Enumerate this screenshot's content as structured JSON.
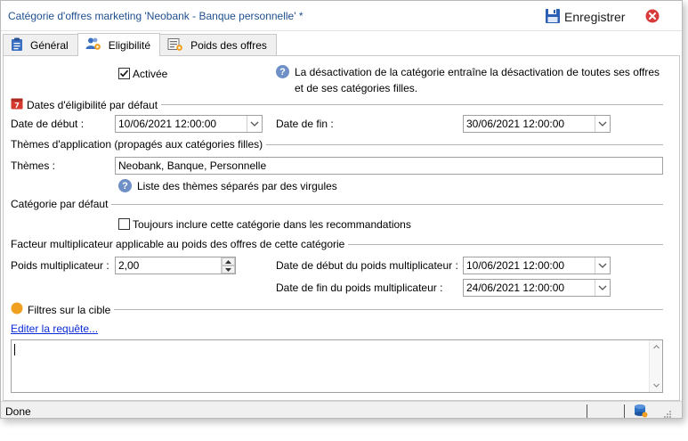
{
  "window": {
    "title": "Catégorie d'offres marketing 'Neobank - Banque personnelle' *",
    "save_label": "Enregistrer"
  },
  "tabs": [
    {
      "label": "Général",
      "icon": "clipboard-icon",
      "active": false
    },
    {
      "label": "Eligibilité",
      "icon": "users-gear-icon",
      "active": true
    },
    {
      "label": "Poids des offres",
      "icon": "form-gear-icon",
      "active": false
    }
  ],
  "eligibility": {
    "active_label": "Activée",
    "active_checked": true,
    "help_text_line1": "La désactivation de la catégorie entraîne la désactivation de toutes ses offres",
    "help_text_line2": "et de ses catégories filles.",
    "dates_section": "Dates d'éligibilité par défaut",
    "start_label": "Date de début :",
    "start_value": "10/06/2021 12:00:00",
    "end_label": "Date de fin :",
    "end_value": "30/06/2021 12:00:00",
    "themes_section": "Thèmes d'application (propagés aux catégories filles)",
    "themes_label": "Thèmes :",
    "themes_value": "Neobank, Banque, Personnelle",
    "themes_help": "Liste des thèmes séparés par des virgules",
    "default_section": "Catégorie par défaut",
    "always_include_label": "Toujours inclure cette catégorie dans les recommandations",
    "always_include_checked": false,
    "factor_section": "Facteur multiplicateur applicable au poids des offres de cette catégorie",
    "weight_label": "Poids multiplicateur :",
    "weight_value": "2,00",
    "weight_start_label": "Date de début du poids multiplicateur :",
    "weight_start_value": "10/06/2021 12:00:00",
    "weight_end_label": "Date de fin du poids multiplicateur :",
    "weight_end_value": "24/06/2021 12:00:00",
    "filters_section": "Filtres sur la cible",
    "edit_query_link": "Editer la requête..."
  },
  "status": {
    "text": "Done"
  },
  "colors": {
    "title": "#1f4f8f",
    "save_icon": "#2b5fb3",
    "close": "#d93b3b",
    "calendar": "#d63a2e",
    "filter_dot": "#f0a020",
    "help": "#6f8fc7",
    "link": "#0b2bd6"
  }
}
